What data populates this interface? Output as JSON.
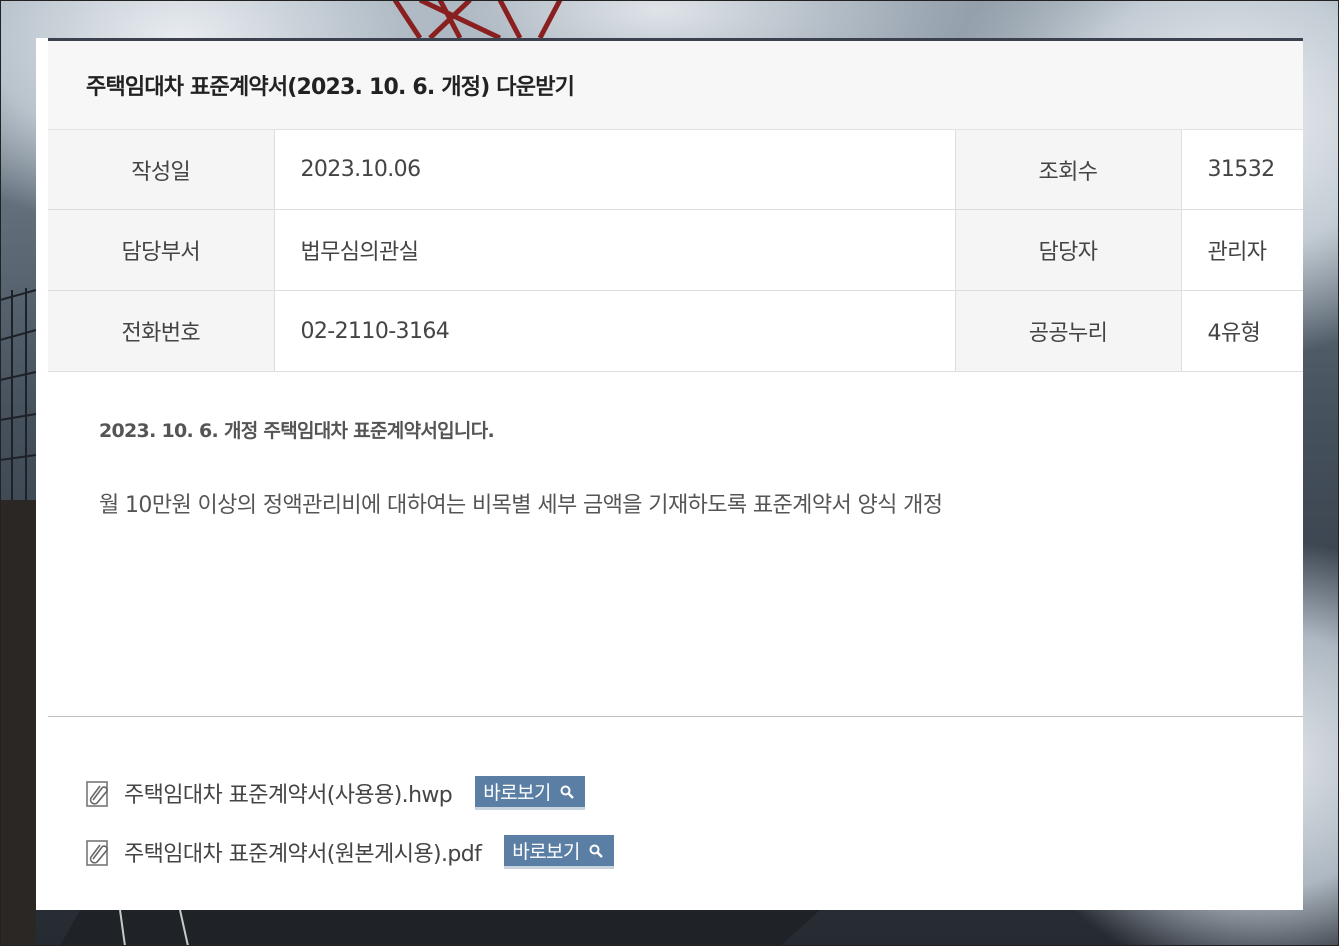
{
  "post": {
    "title": "주택임대차 표준계약서(2023. 10. 6. 개정) 다운받기",
    "meta": {
      "date_label": "작성일",
      "date_value": "2023.10.06",
      "views_label": "조회수",
      "views_value": "31532",
      "department_label": "담당부서",
      "department_value": "법무심의관실",
      "manager_label": "담당자",
      "manager_value": "관리자",
      "phone_label": "전화번호",
      "phone_value": "02-2110-3164",
      "kogl_label": "공공누리",
      "kogl_value": "4유형"
    },
    "content": {
      "lead": "2023. 10. 6. 개정 주택임대차 표준계약서입니다.",
      "body": "월 10만원 이상의 정액관리비에 대하여는 비목별 세부 금액을 기재하도록 표준계약서 양식 개정"
    },
    "attachments": [
      {
        "icon": "paperclip-icon",
        "name": "주택임대차 표준계약서(사용용).hwp",
        "preview_label": "바로보기"
      },
      {
        "icon": "paperclip-icon",
        "name": "주택임대차 표준계약서(원본게시용).pdf",
        "preview_label": "바로보기"
      }
    ]
  },
  "colors": {
    "title_border": "#3c4150",
    "preview_button": "#5a7ea4",
    "label_cell_bg": "#f5f5f5"
  }
}
